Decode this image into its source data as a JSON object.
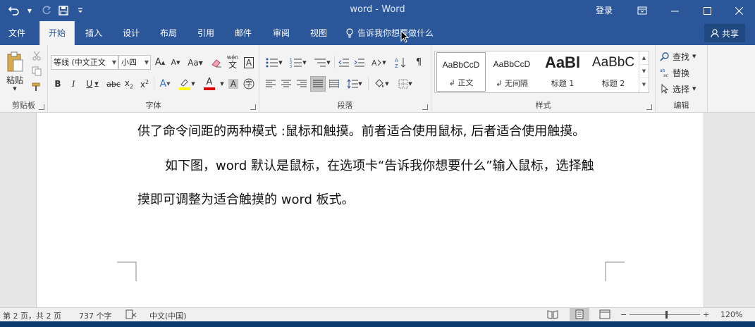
{
  "window": {
    "title": "word  -  Word",
    "signin": "登录",
    "share": "共享"
  },
  "tabs": [
    {
      "label": "文件",
      "active": false
    },
    {
      "label": "开始",
      "active": true
    },
    {
      "label": "插入",
      "active": false
    },
    {
      "label": "设计",
      "active": false
    },
    {
      "label": "布局",
      "active": false
    },
    {
      "label": "引用",
      "active": false
    },
    {
      "label": "邮件",
      "active": false
    },
    {
      "label": "审阅",
      "active": false
    },
    {
      "label": "视图",
      "active": false
    }
  ],
  "tell_me": "告诉我你想要做什么",
  "ribbon": {
    "clipboard": {
      "label": "剪贴板",
      "paste": "粘贴"
    },
    "font": {
      "label": "字体",
      "font_name": "等线 (中文正文",
      "font_size": "小四",
      "font_glyph": "A",
      "wen": "wén",
      "wen_char": "文"
    },
    "paragraph": {
      "label": "段落"
    },
    "styles": {
      "label": "样式",
      "items": [
        {
          "sample": "AaBbCcD",
          "name": "↲ 正文"
        },
        {
          "sample": "AaBbCcD",
          "name": "↲ 无间隔"
        },
        {
          "sample": "AaBl",
          "name": "标题 1"
        },
        {
          "sample": "AaBbC",
          "name": "标题 2"
        }
      ]
    },
    "editing": {
      "label": "编辑",
      "find": "查找",
      "replace": "替换",
      "select": "选择"
    }
  },
  "document": {
    "lines": [
      "供了命令间距的两种模式 :鼠标和触摸。前者适合使用鼠标, 后者适合使用触摸。",
      "如下图，word 默认是鼠标，在选项卡“告诉我你想要什么”输入鼠标，选择触",
      "摸即可调整为适合触摸的 word 板式。"
    ]
  },
  "status": {
    "page": "第 2 页，共 2 页",
    "words": "737 个字",
    "language": "中文(中国)",
    "zoom_minus": "−",
    "zoom_plus": "+",
    "zoom": "120%",
    "zoom_level": 0.52
  },
  "colors": {
    "titlebar": "#2b579a",
    "ribbon": "#f3f3f3",
    "highlight": "#ffff00",
    "font_color": "#e00000"
  }
}
